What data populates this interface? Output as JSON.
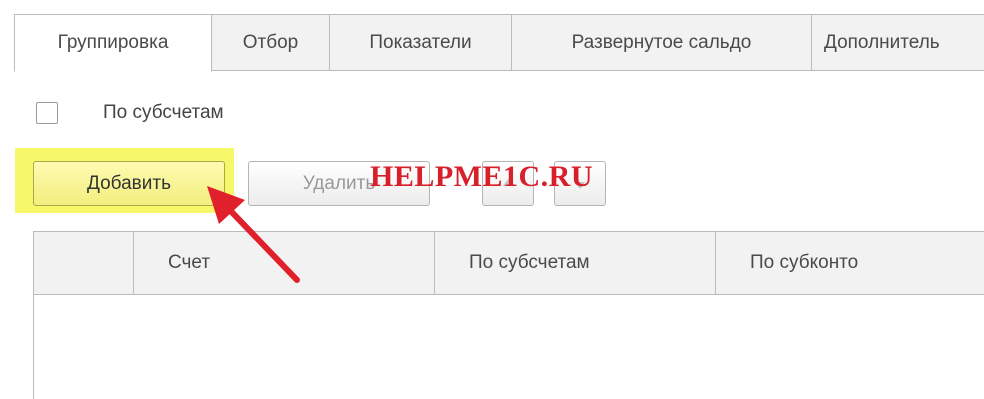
{
  "tabs": [
    {
      "label": "Группировка",
      "active": true
    },
    {
      "label": "Отбор",
      "active": false
    },
    {
      "label": "Показатели",
      "active": false
    },
    {
      "label": "Развернутое сальдо",
      "active": false
    },
    {
      "label": "Дополнитель",
      "active": false
    }
  ],
  "checkbox": {
    "label": "По субсчетам",
    "checked": false
  },
  "toolbar": {
    "add_label": "Добавить",
    "delete_label": "Удалить",
    "up_icon": "arrow-up-icon",
    "down_icon": "arrow-down-icon"
  },
  "watermark": "HELPME1C.RU",
  "table": {
    "columns": [
      "",
      "Счет",
      "По субсчетам",
      "По субконто"
    ],
    "rows": []
  },
  "colors": {
    "highlight": "#f7f76a",
    "arrow": "#e0202a",
    "watermark": "#d8202c"
  }
}
